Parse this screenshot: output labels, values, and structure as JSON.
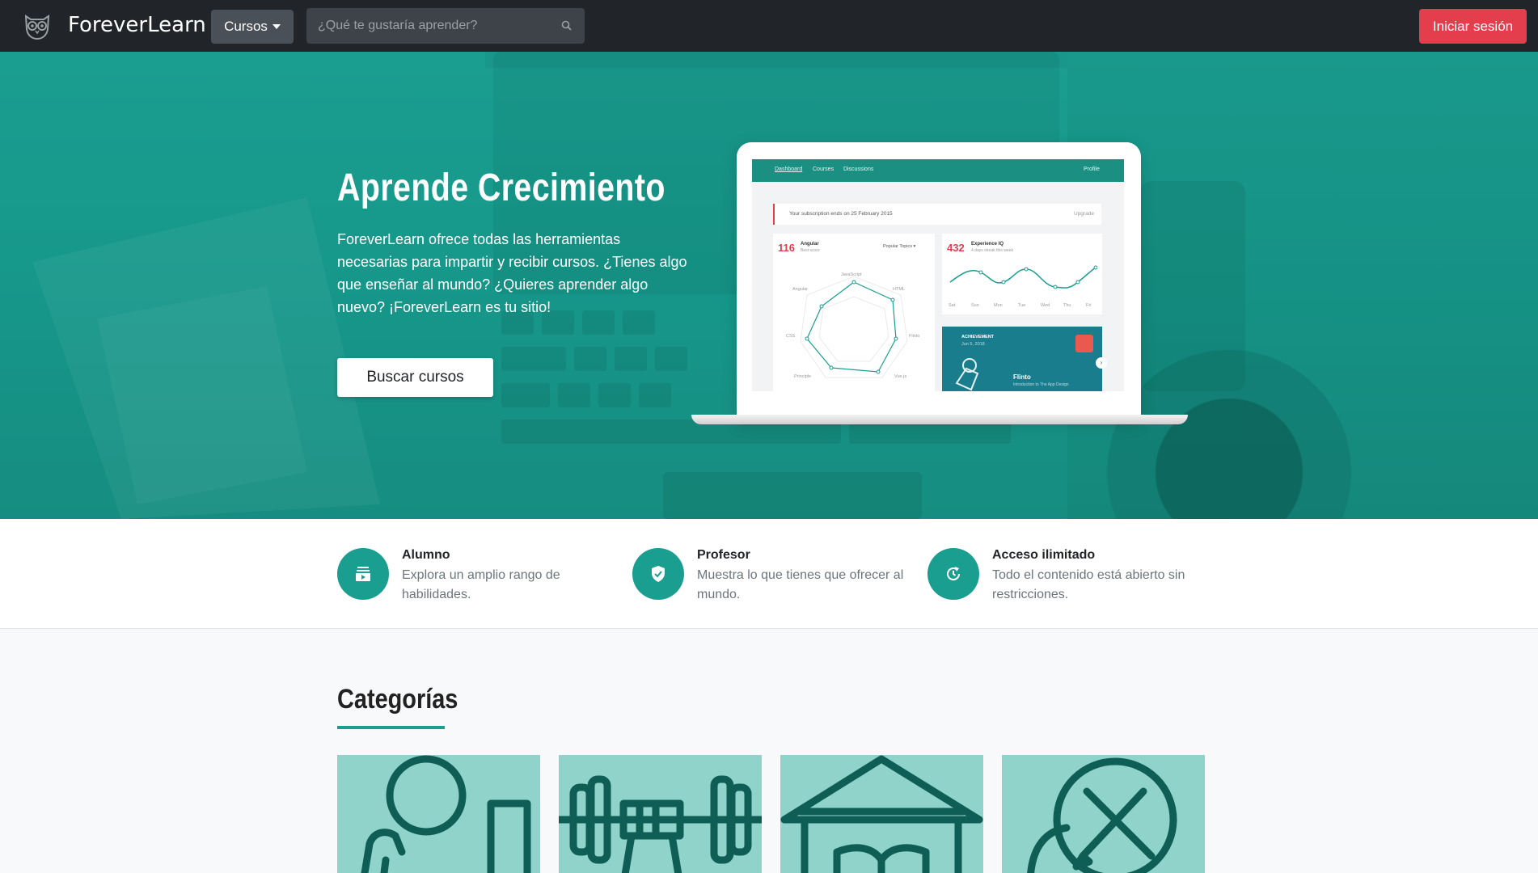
{
  "navbar": {
    "brand": "ForeverLearn",
    "courses_label": "Cursos",
    "search_placeholder": "¿Qué te gustaría aprender?",
    "login_label": "Iniciar sesión"
  },
  "hero": {
    "title": "Aprende Crecimiento",
    "text": "ForeverLearn ofrece todas las herramientas necesarias para impartir y recibir cursos. ¿Tienes algo que enseñar al mundo? ¿Quieres aprender algo nuevo? ¡ForeverLearn es tu sitio!",
    "cta_label": "Buscar cursos"
  },
  "dashboard": {
    "tabs": [
      "Dashboard",
      "Courses",
      "Discussions"
    ],
    "profile": "Profile",
    "subscription_text": "Your subscription ends on 25 February 2015",
    "upgrade": "Upgrade",
    "card1": {
      "num": "116",
      "label": "Angular",
      "sub": "Best score",
      "dropdown": "Popular Topics ▾",
      "axes": [
        "JavaScript",
        "HTML",
        "Flinto",
        "Vue.js",
        "Principle",
        "CSS",
        "Angular"
      ]
    },
    "card2": {
      "num": "432",
      "label": "Experience IQ",
      "sub": "4 days streak this week",
      "days": [
        "Sat",
        "Sun",
        "Mon",
        "Tue",
        "Wed",
        "Thu",
        "Fri"
      ]
    },
    "card3": {
      "tag": "ACHIEVEMENT",
      "date": "Jun 5, 2018",
      "name": "Flinto",
      "desc": "Introduction to The App Design"
    }
  },
  "features": [
    {
      "title": "Alumno",
      "desc": "Explora un amplio rango de habilidades.",
      "icon": "video-library-icon"
    },
    {
      "title": "Profesor",
      "desc": "Muestra lo que tienes que ofrecer al mundo.",
      "icon": "verified-shield-icon"
    },
    {
      "title": "Acceso ilimitado",
      "desc": "Todo el contenido está abierto sin restricciones.",
      "icon": "unlimited-access-icon"
    }
  ],
  "categories": {
    "title": "Categorías",
    "items": [
      {
        "icon": "person-thinking-icon"
      },
      {
        "icon": "fitness-dumbbell-icon"
      },
      {
        "icon": "museum-book-icon"
      },
      {
        "icon": "design-tools-icon"
      }
    ]
  },
  "colors": {
    "accent": "#1a9e90",
    "navbar": "#212529",
    "login": "#e43d4b",
    "category_bg": "#8fd3ca",
    "category_stroke": "#0f5e56"
  }
}
